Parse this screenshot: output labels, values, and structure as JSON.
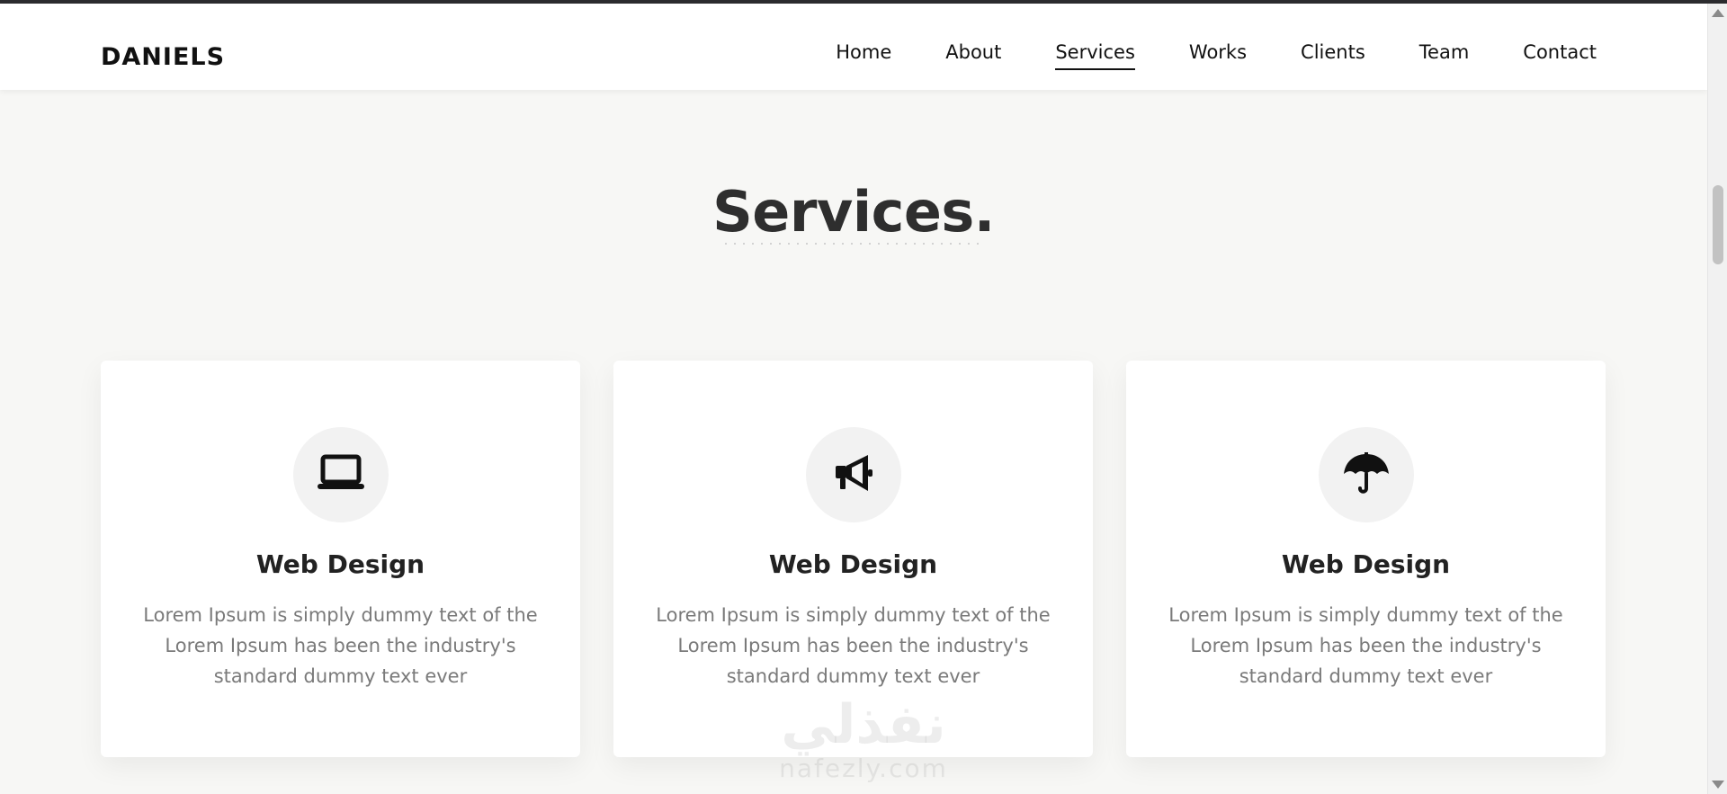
{
  "brand": {
    "logo": "DANIELS"
  },
  "nav": {
    "items": [
      {
        "label": "Home",
        "active": false
      },
      {
        "label": "About",
        "active": false
      },
      {
        "label": "Services",
        "active": true
      },
      {
        "label": "Works",
        "active": false
      },
      {
        "label": "Clients",
        "active": false
      },
      {
        "label": "Team",
        "active": false
      },
      {
        "label": "Contact",
        "active": false
      }
    ]
  },
  "services": {
    "title": "Services.",
    "cards": [
      {
        "icon": "laptop-icon",
        "title": "Web Design",
        "text": "Lorem Ipsum is simply dummy text of the Lorem Ipsum has been the industry's standard dummy text ever"
      },
      {
        "icon": "megaphone-icon",
        "title": "Web Design",
        "text": "Lorem Ipsum is simply dummy text of the Lorem Ipsum has been the industry's standard dummy text ever"
      },
      {
        "icon": "umbrella-icon",
        "title": "Web Design",
        "text": "Lorem Ipsum is simply dummy text of the Lorem Ipsum has been the industry's standard dummy text ever"
      }
    ]
  },
  "watermark": {
    "arabic": "نفذلي",
    "latin": "nafezly.com"
  },
  "colors": {
    "accent": "#111111",
    "background": "#f7f7f5",
    "card": "#ffffff",
    "muted_text": "#7a7a7a"
  }
}
